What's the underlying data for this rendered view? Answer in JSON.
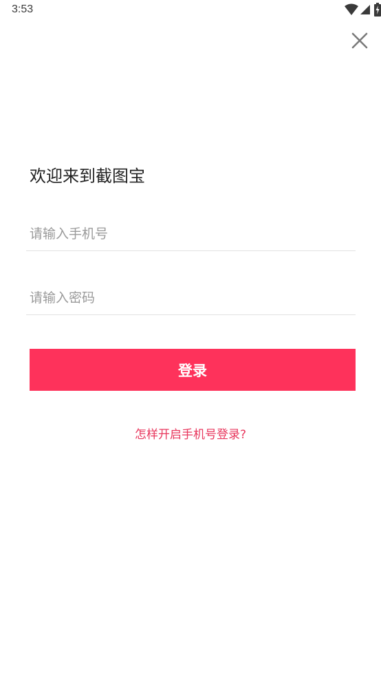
{
  "status_bar": {
    "time": "3:53",
    "icons": [
      "wifi-icon",
      "cell-signal-icon",
      "battery-charging-icon"
    ]
  },
  "close_button": {
    "icon": "close-icon"
  },
  "login": {
    "title": "欢迎来到截图宝",
    "phone_placeholder": "请输入手机号",
    "phone_value": "",
    "password_placeholder": "请输入密码",
    "password_value": "",
    "submit_label": "登录",
    "help_link": "怎样开启手机号登录?"
  },
  "colors": {
    "accent": "#fe325b",
    "link": "#e8365c",
    "divider": "#e2e2e2",
    "placeholder": "#9a9a9a"
  }
}
